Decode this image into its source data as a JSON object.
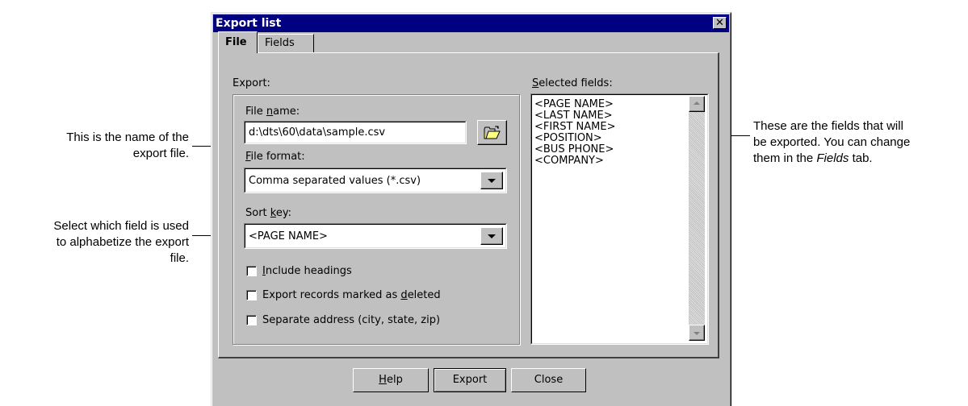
{
  "dialog": {
    "title": "Export list",
    "close_glyph": "✕"
  },
  "tabs": [
    {
      "label": "File",
      "active": true
    },
    {
      "label": "Fields",
      "active": false
    }
  ],
  "export_group": {
    "label": "Export:",
    "file_name": {
      "label_pre": "File ",
      "label_u": "n",
      "label_post": "ame:",
      "value": "d:\\dts\\60\\data\\sample.csv"
    },
    "browse_icon": "open-folder-icon",
    "file_format": {
      "label_u": "F",
      "label_post": "ile format:",
      "value": "Comma separated values (*.csv)"
    },
    "sort_key": {
      "label_pre": "Sort ",
      "label_u": "k",
      "label_post": "ey:",
      "value": "<PAGE NAME>"
    },
    "checkboxes": [
      {
        "pre": "",
        "u": "I",
        "post": "nclude headings",
        "checked": false
      },
      {
        "pre": "Export records marked as ",
        "u": "d",
        "post": "eleted",
        "checked": false
      },
      {
        "pre": "Separate address (city, state, zip)",
        "u": "",
        "post": "",
        "checked": false
      }
    ]
  },
  "selected_fields": {
    "label_u": "S",
    "label_post": "elected fields:",
    "items": [
      "<PAGE NAME>",
      "<LAST NAME>",
      "<FIRST NAME>",
      "<POSITION>",
      "<BUS PHONE>",
      "<COMPANY>"
    ]
  },
  "buttons": {
    "help_u": "H",
    "help_post": "elp",
    "export": "Export",
    "close": "Close"
  },
  "annotations": {
    "file_name_line1": "This is the name of the",
    "file_name_line2": "export file.",
    "sort_key_line1": "Select which field is used",
    "sort_key_line2": "to alphabetize the export",
    "sort_key_line3": "file.",
    "fields_line1": "These are the fields that will",
    "fields_line2": "be exported. You can change",
    "fields_line3_pre": "them in the ",
    "fields_line3_em": "Fields",
    "fields_line3_post": " tab."
  }
}
